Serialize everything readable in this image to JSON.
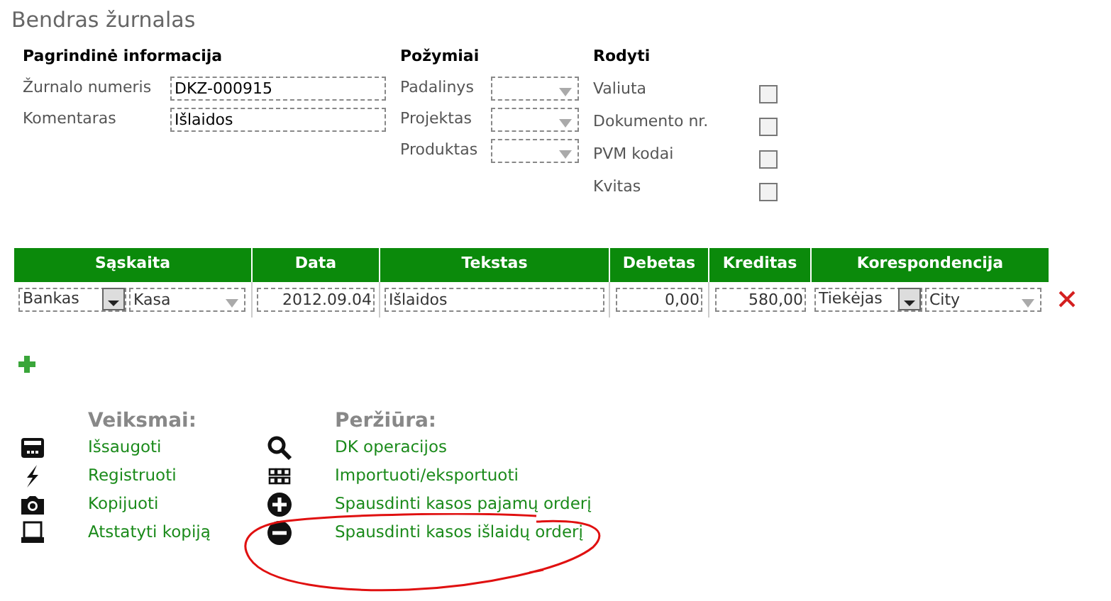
{
  "title": "Bendras žurnalas",
  "basic": {
    "heading": "Pagrindinė informacija",
    "fields": [
      {
        "label": "Žurnalo numeris",
        "value": "DKZ-000915"
      },
      {
        "label": "Komentaras",
        "value": "Išlaidos"
      }
    ]
  },
  "attributes": {
    "heading": "Požymiai",
    "fields": [
      {
        "label": "Padalinys"
      },
      {
        "label": "Projektas"
      },
      {
        "label": "Produktas"
      }
    ]
  },
  "show": {
    "heading": "Rodyti",
    "options": [
      {
        "label": "Valiuta",
        "checked": false
      },
      {
        "label": "Dokumento nr.",
        "checked": false
      },
      {
        "label": "PVM kodai",
        "checked": false
      },
      {
        "label": "Kvitas",
        "checked": false
      }
    ]
  },
  "table": {
    "columns": [
      "Sąskaita",
      "Data",
      "Tekstas",
      "Debetas",
      "Kreditas",
      "Korespondencija"
    ],
    "rows": [
      {
        "account_type": "Bankas",
        "account": "Kasa",
        "date": "2012.09.04",
        "text": "Išlaidos",
        "debit": "0,00",
        "credit": "580,00",
        "corr_type": "Tiekėjas",
        "corr": "City"
      }
    ]
  },
  "actions": {
    "heading": "Veiksmai:",
    "items": [
      {
        "kind": "save",
        "label": "Išsaugoti"
      },
      {
        "kind": "register",
        "label": "Registruoti"
      },
      {
        "kind": "copy",
        "label": "Kopijuoti"
      },
      {
        "kind": "restore",
        "label": "Atstatyti kopiją"
      }
    ]
  },
  "view": {
    "heading": "Peržiūra:",
    "items": [
      {
        "kind": "search",
        "label": "DK operacijos"
      },
      {
        "kind": "grid",
        "label": "Importuoti/eksportuoti"
      },
      {
        "kind": "plus",
        "label": "Spausdinti kasos pajamų orderį"
      },
      {
        "kind": "minus",
        "label": "Spausdinti kasos išlaidų orderį"
      }
    ]
  }
}
